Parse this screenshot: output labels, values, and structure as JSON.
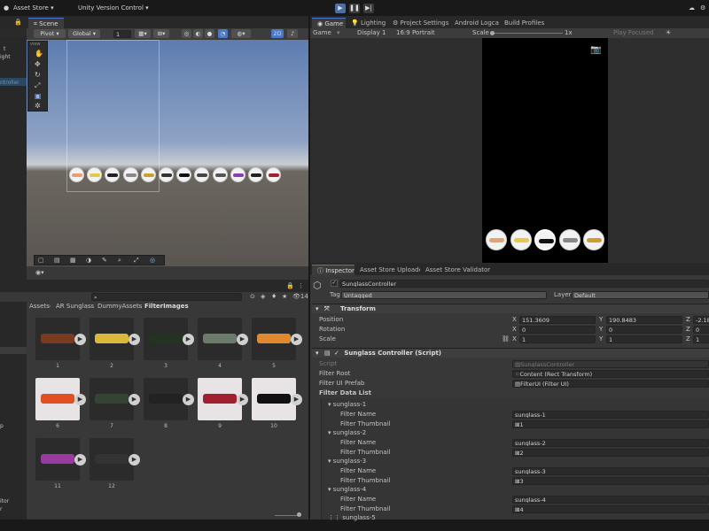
{
  "topbar": {
    "asset_store": "Asset Store ▾",
    "version_control": "Unity Version Control ▾",
    "play": "▶",
    "pause": "❚❚",
    "step": "▶|"
  },
  "hierarchy": {
    "items": [
      "t",
      "ight",
      "",
      "",
      "ntroller"
    ]
  },
  "scene": {
    "tab": "Scene",
    "toolbar": {
      "pivot": "Pivot ▾",
      "global": "Global ▾",
      "snap": "1",
      "mode2d": "2D"
    },
    "gizmo_label": "view"
  },
  "game": {
    "tab": "Game",
    "tabs": [
      "Lighting",
      "Project Settings",
      "Android Logcat",
      "Build Profiles"
    ],
    "toolbar": {
      "game": "Game",
      "display": "Display 1",
      "aspect": "16:9 Portrait",
      "scale_label": "Scale",
      "scale_value": "1x",
      "play_focused": "Play Focused"
    }
  },
  "project": {
    "breadcrumb": [
      "Assets",
      "AR Sunglass",
      "DummyAssets",
      "FilterImages"
    ],
    "count": "14",
    "left_items": [
      "p",
      "itor",
      "r"
    ],
    "items": [
      "1",
      "2",
      "3",
      "4",
      "5",
      "6",
      "7",
      "8",
      "9",
      "10",
      "11",
      "12"
    ]
  },
  "inspector": {
    "tabs": [
      "Inspector",
      "Asset Store Uploader",
      "Asset Store Validator"
    ],
    "object_name": "SunglassController",
    "tag_label": "Tag",
    "tag_value": "Untagged",
    "layer_label": "Layer",
    "layer_value": "Default",
    "transform": {
      "title": "Transform",
      "position_label": "Position",
      "rotation_label": "Rotation",
      "scale_label": "Scale",
      "position": {
        "x": "151.3609",
        "y": "190.8483",
        "z": "-2.18"
      },
      "rotation": {
        "x": "0",
        "y": "0",
        "z": "0"
      },
      "scale": {
        "x": "1",
        "y": "1",
        "z": "1"
      }
    },
    "script_component": {
      "title": "Sunglass Controller (Script)",
      "script_label": "Script",
      "script_value": "SunglassController",
      "filter_root_label": "Filter Root",
      "filter_root_value": "Content (Rect Transform)",
      "filter_prefab_label": "Filter UI Prefab",
      "filter_prefab_value": "FilterUI (Filter UI)",
      "data_list_label": "Filter Data List",
      "entries": [
        {
          "title": "sunglass-1",
          "name": "sunglass-1",
          "thumb": "1"
        },
        {
          "title": "sunglass-2",
          "name": "sunglass-2",
          "thumb": "2"
        },
        {
          "title": "sunglass-3",
          "name": "sunglass-3",
          "thumb": "3"
        },
        {
          "title": "sunglass-4",
          "name": "sunglass-4",
          "thumb": "4"
        }
      ],
      "entry5_title": "sunglass-5",
      "filter_name_label": "Filter Name",
      "filter_thumbnail_label": "Filter Thumbnail"
    }
  },
  "colors": {
    "accent": "#4b77c7",
    "panel": "#383838",
    "field": "#2a2a2a",
    "game_bg": "#000000"
  }
}
